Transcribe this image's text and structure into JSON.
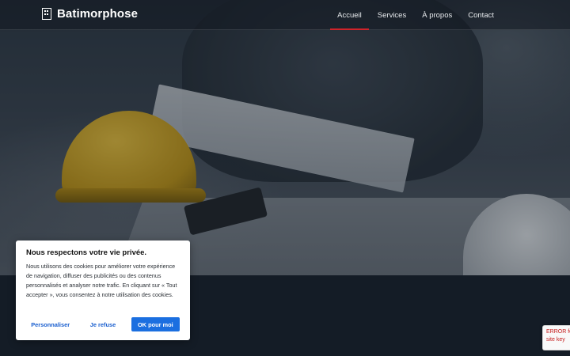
{
  "header": {
    "brand": "Batimorphose",
    "brand_icon": "building-icon",
    "nav": [
      {
        "label": "Accueil",
        "active": true
      },
      {
        "label": "Services",
        "active": false
      },
      {
        "label": "À propos",
        "active": false
      },
      {
        "label": "Contact",
        "active": false
      }
    ]
  },
  "cookie": {
    "title": "Nous respectons votre vie privée.",
    "text": "Nous utilisons des cookies pour améliorer votre expérience de navigation, diffuser des publicités ou des contenus personnalisés et analyser notre trafic. En cliquant sur « Tout accepter », vous consentez à notre utilisation des cookies.",
    "customize_label": "Personnaliser",
    "refuse_label": "Je refuse",
    "accept_label": "OK pour moi"
  },
  "recaptcha": {
    "line1": "ERROR for",
    "line2": "site key"
  },
  "colors": {
    "accent": "#d0232a",
    "primary_button": "#1b6fe0",
    "page_background": "#141c26"
  }
}
